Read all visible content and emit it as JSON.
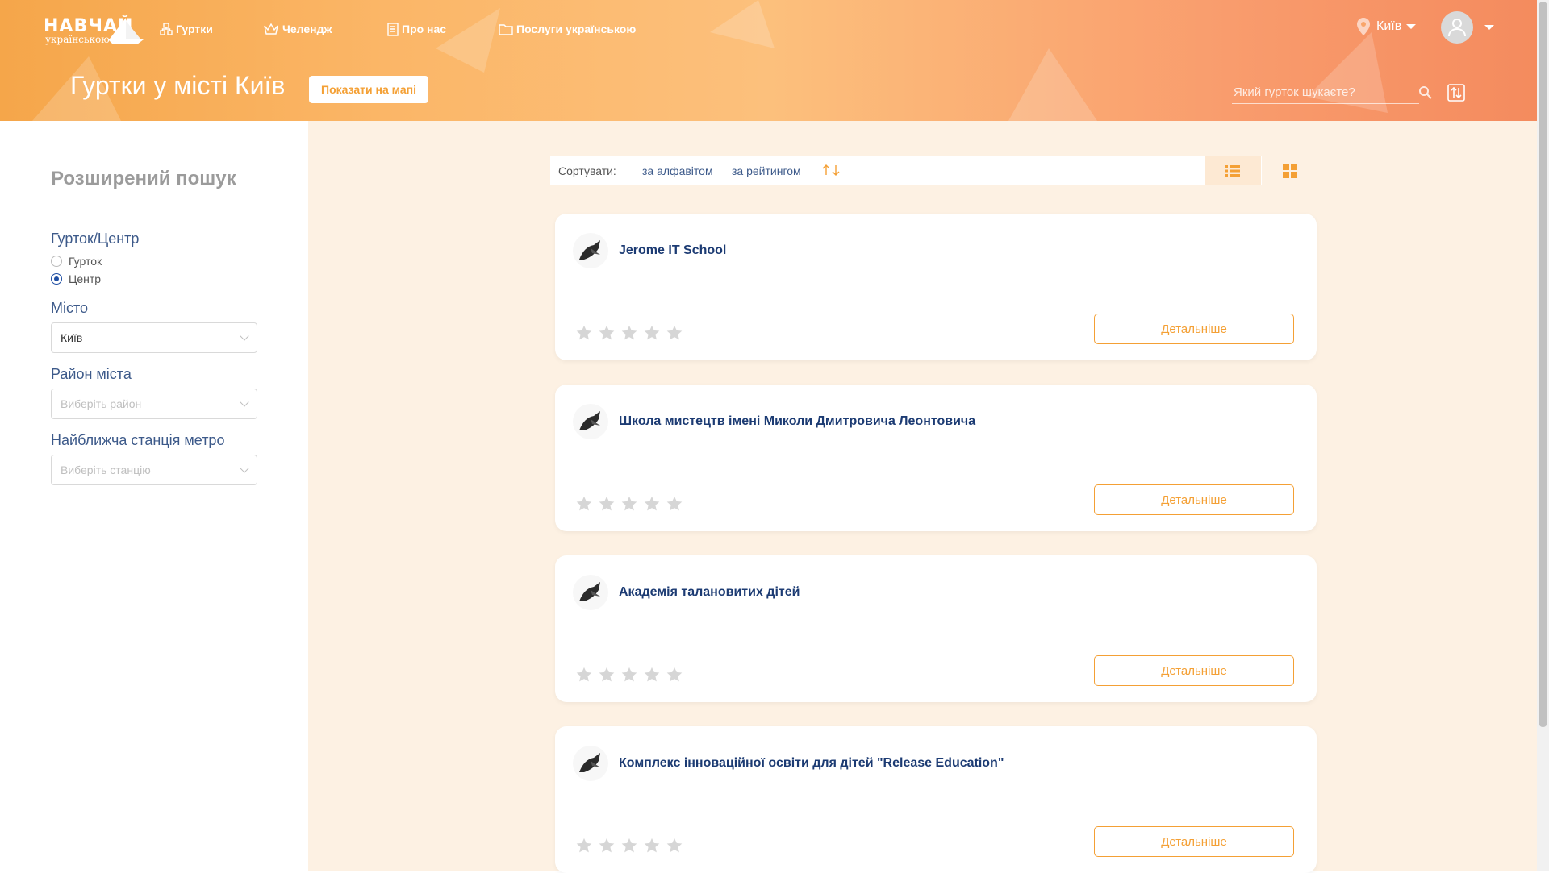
{
  "header": {
    "logo_line1": "НАВЧАЙ",
    "logo_line2": "українською",
    "nav": [
      {
        "label": "Гуртки",
        "icon": "clubs-icon"
      },
      {
        "label": "Челендж",
        "icon": "crown-icon"
      },
      {
        "label": "Про нас",
        "icon": "document-icon"
      },
      {
        "label": "Послуги українською",
        "icon": "folder-icon"
      }
    ],
    "city": "Київ",
    "title": "Гуртки у місті Київ",
    "map_button": "Показати на мапі",
    "search_placeholder": "Який гурток шукаєте?"
  },
  "sidebar": {
    "title": "Розширений пошук",
    "type_label": "Гурток/Центр",
    "type_options": [
      "Гурток",
      "Центр"
    ],
    "type_selected": "Центр",
    "city_label": "Місто",
    "city_value": "Київ",
    "district_label": "Район міста",
    "district_placeholder": "Виберіть район",
    "metro_label": "Найближча станція метро",
    "metro_placeholder": "Виберіть станцію"
  },
  "sort": {
    "label": "Сортувати:",
    "by_alphabet": "за алфавітом",
    "by_rating": "за рейтингом",
    "view_mode": "list"
  },
  "cards": [
    {
      "name": "Jerome IT School",
      "rating": 0,
      "button": "Детальніше"
    },
    {
      "name": "Школа мистецтв імені Миколи Дмитровича Леонтовича",
      "rating": 0,
      "button": "Детальніше"
    },
    {
      "name": "Академія талановитих дітей",
      "rating": 0,
      "button": "Детальніше"
    },
    {
      "name": "Комплекс інноваційної освіти для дітей \"Release Education\"",
      "rating": 0,
      "button": "Детальніше"
    }
  ],
  "colors": {
    "accent": "#f4a035",
    "navy": "#1c3b73",
    "main_bg": "#fdf1e3"
  }
}
